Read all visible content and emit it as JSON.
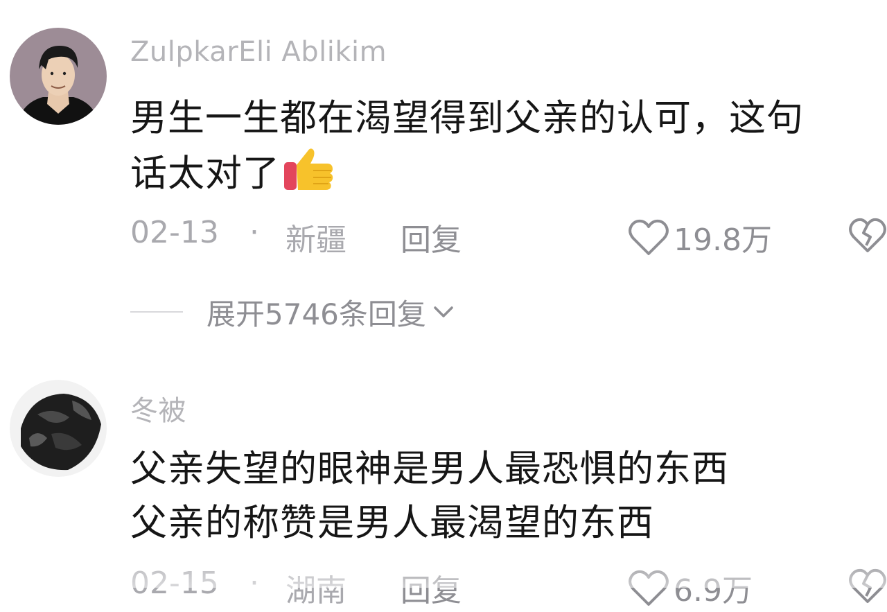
{
  "comments": [
    {
      "username": "ZulpkarEli Ablikim",
      "text_lines": [
        "男生一生都在渴望得到父亲的认可，这句",
        "话太对了"
      ],
      "emoji": "thumbs-up-icon",
      "date": "02-13",
      "separator": "·",
      "location": "新疆",
      "reply_label": "回复",
      "like_count": "19.8万",
      "expand_replies_label": "展开5746条回复"
    },
    {
      "username": "冬被",
      "text_lines": [
        "父亲失望的眼神是男人最恐惧的东西",
        "父亲的称赞是男人最渴望的东西"
      ],
      "date": "02-15",
      "separator": "·",
      "location": "湖南",
      "reply_label": "回复",
      "like_count": "6.9万"
    }
  ],
  "colors": {
    "text": "#161616",
    "meta": "#a9a9ae",
    "username": "#b4b4b8",
    "avatar_bg": "#9b8a94"
  },
  "icons": [
    "heart-outline-icon",
    "broken-heart-icon",
    "chevron-down-icon",
    "thumbs-up-icon"
  ]
}
